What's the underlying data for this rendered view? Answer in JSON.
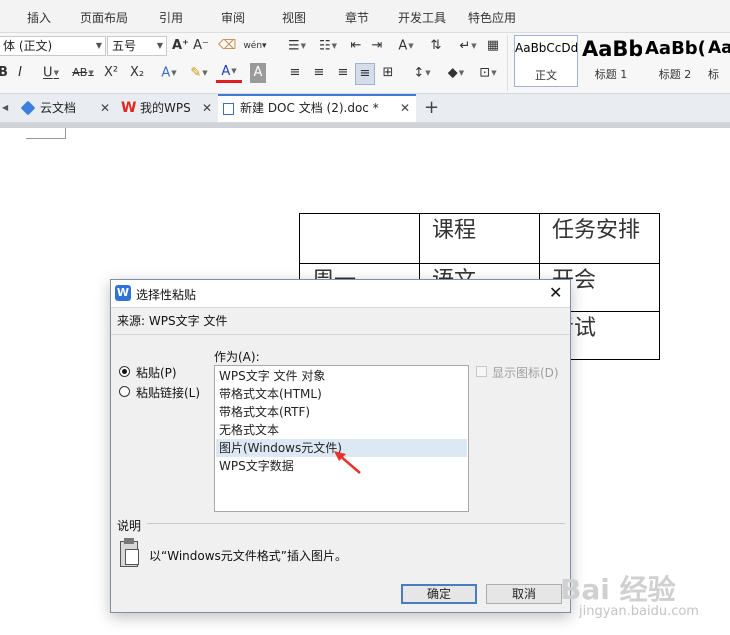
{
  "menu": [
    "插入",
    "页面布局",
    "引用",
    "审阅",
    "视图",
    "章节",
    "开发工具",
    "特色应用"
  ],
  "toolbar": {
    "font_name": "体 (正文)",
    "font_size": "五号",
    "styles": [
      {
        "preview": "AaBbCcDd",
        "name": "正文"
      },
      {
        "preview": "AaBb",
        "name": "标题 1"
      },
      {
        "preview": "AaBb(",
        "name": "标题 2"
      },
      {
        "preview": "Aa",
        "name": "标"
      }
    ]
  },
  "tabs": [
    {
      "label": "云文档"
    },
    {
      "label": "我的WPS"
    },
    {
      "label": "新建 DOC 文档 (2).doc *"
    }
  ],
  "document": {
    "table": [
      [
        "",
        "课程",
        "任务安排"
      ],
      [
        "周一",
        "语文",
        "开会"
      ],
      [
        "",
        "",
        "考试"
      ]
    ]
  },
  "dialog": {
    "title": "选择性粘贴",
    "source": "来源: WPS文字 文件",
    "as_label": "作为(A):",
    "radio_paste": "粘贴(P)",
    "radio_link": "粘贴链接(L)",
    "show_icon": "显示图标(D)",
    "list": [
      "WPS文字 文件 对象",
      "带格式文本(HTML)",
      "带格式文本(RTF)",
      "无格式文本",
      "图片(Windows元文件)",
      "WPS文字数据"
    ],
    "selected_index": 4,
    "desc_label": "说明",
    "description": "以“Windows元文件格式”插入图片。",
    "ok": "确定",
    "cancel": "取消"
  },
  "watermark": {
    "brand": "Bai 经验",
    "url": "jingyan.baidu.com"
  },
  "colors": {
    "accent": "#2f73d6",
    "selection": "#dde8f5",
    "arrow": "#e8332b",
    "watermark": "#d0d0d0"
  }
}
